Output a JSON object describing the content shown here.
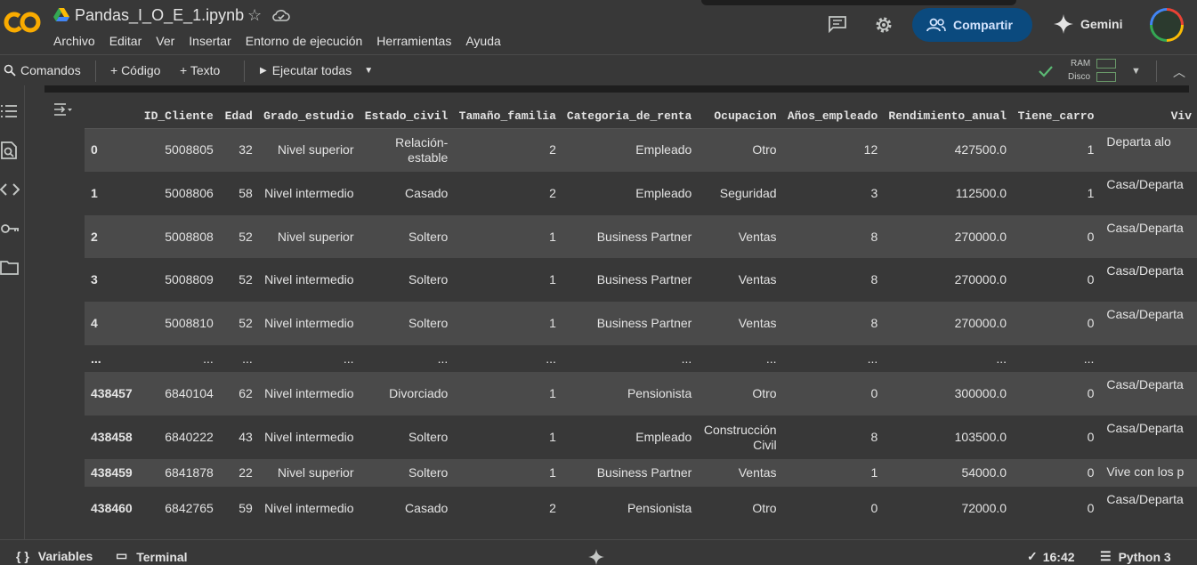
{
  "header": {
    "notebook_title": "Pandas_I_O_E_1.ipynb",
    "menu": [
      "Archivo",
      "Editar",
      "Ver",
      "Insertar",
      "Entorno de ejecución",
      "Herramientas",
      "Ayuda"
    ],
    "share_label": "Compartir",
    "gemini_label": "Gemini"
  },
  "toolbar": {
    "commands_label": "Comandos",
    "code_label": "+ Código",
    "text_label": "+ Texto",
    "run_all_label": "Ejecutar todas",
    "ram_label": "RAM",
    "disk_label": "Disco"
  },
  "dataframe": {
    "columns": [
      "",
      "ID_Cliente",
      "Edad",
      "Grado_estudio",
      "Estado_civil",
      "Tamaño_familia",
      "Categoria_de_renta",
      "Ocupacion",
      "Años_empleado",
      "Rendimiento_anual",
      "Tiene_carro",
      "Viv"
    ],
    "rows": [
      [
        "0",
        "5008805",
        "32",
        "Nivel superior",
        "Relación-estable",
        "2",
        "Empleado",
        "Otro",
        "12",
        "427500.0",
        "1",
        "Departa alo"
      ],
      [
        "1",
        "5008806",
        "58",
        "Nivel intermedio",
        "Casado",
        "2",
        "Empleado",
        "Seguridad",
        "3",
        "112500.0",
        "1",
        "Casa/Departa"
      ],
      [
        "2",
        "5008808",
        "52",
        "Nivel superior",
        "Soltero",
        "1",
        "Business Partner",
        "Ventas",
        "8",
        "270000.0",
        "0",
        "Casa/Departa"
      ],
      [
        "3",
        "5008809",
        "52",
        "Nivel intermedio",
        "Soltero",
        "1",
        "Business Partner",
        "Ventas",
        "8",
        "270000.0",
        "0",
        "Casa/Departa"
      ],
      [
        "4",
        "5008810",
        "52",
        "Nivel intermedio",
        "Soltero",
        "1",
        "Business Partner",
        "Ventas",
        "8",
        "270000.0",
        "0",
        "Casa/Departa"
      ],
      [
        "...",
        "...",
        "...",
        "...",
        "...",
        "...",
        "...",
        "...",
        "...",
        "...",
        "...",
        ""
      ],
      [
        "438457",
        "6840104",
        "62",
        "Nivel intermedio",
        "Divorciado",
        "1",
        "Pensionista",
        "Otro",
        "0",
        "300000.0",
        "0",
        "Casa/Departa"
      ],
      [
        "438458",
        "6840222",
        "43",
        "Nivel intermedio",
        "Soltero",
        "1",
        "Empleado",
        "Construcción Civil",
        "8",
        "103500.0",
        "0",
        "Casa/Departa"
      ],
      [
        "438459",
        "6841878",
        "22",
        "Nivel superior",
        "Soltero",
        "1",
        "Business Partner",
        "Ventas",
        "1",
        "54000.0",
        "0",
        "Vive con los p"
      ],
      [
        "438460",
        "6842765",
        "59",
        "Nivel intermedio",
        "Casado",
        "2",
        "Pensionista",
        "Otro",
        "0",
        "72000.0",
        "0",
        "Casa/Departa"
      ]
    ]
  },
  "statusbar": {
    "variables_label": "Variables",
    "terminal_label": "Terminal",
    "time_label": "16:42",
    "runtime_label": "Python 3"
  }
}
